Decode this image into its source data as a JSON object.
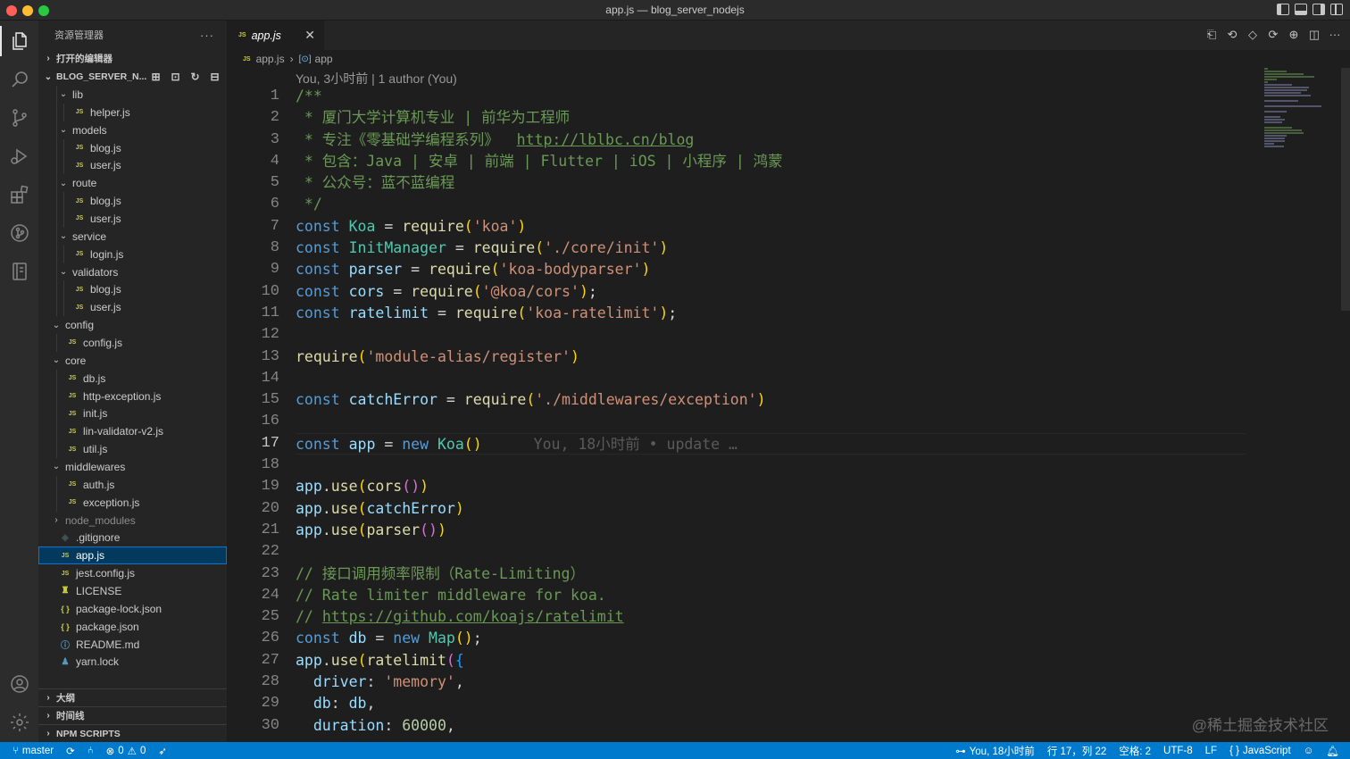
{
  "window": {
    "title": "app.js — blog_server_nodejs"
  },
  "sidebar": {
    "header": "资源管理器",
    "open_editors": "打开的编辑器",
    "project": "BLOG_SERVER_N...",
    "tree": [
      {
        "label": "lib",
        "type": "folder",
        "depth": 1
      },
      {
        "label": "helper.js",
        "type": "js",
        "depth": 2
      },
      {
        "label": "models",
        "type": "folder",
        "depth": 1
      },
      {
        "label": "blog.js",
        "type": "js",
        "depth": 2
      },
      {
        "label": "user.js",
        "type": "js",
        "depth": 2
      },
      {
        "label": "route",
        "type": "folder",
        "depth": 1
      },
      {
        "label": "blog.js",
        "type": "js",
        "depth": 2
      },
      {
        "label": "user.js",
        "type": "js",
        "depth": 2
      },
      {
        "label": "service",
        "type": "folder",
        "depth": 1
      },
      {
        "label": "login.js",
        "type": "js",
        "depth": 2
      },
      {
        "label": "validators",
        "type": "folder",
        "depth": 1
      },
      {
        "label": "blog.js",
        "type": "js",
        "depth": 2
      },
      {
        "label": "user.js",
        "type": "js",
        "depth": 2
      },
      {
        "label": "config",
        "type": "folder",
        "depth": 0
      },
      {
        "label": "config.js",
        "type": "js",
        "depth": 1
      },
      {
        "label": "core",
        "type": "folder",
        "depth": 0
      },
      {
        "label": "db.js",
        "type": "js",
        "depth": 1
      },
      {
        "label": "http-exception.js",
        "type": "js",
        "depth": 1
      },
      {
        "label": "init.js",
        "type": "js",
        "depth": 1
      },
      {
        "label": "lin-validator-v2.js",
        "type": "js",
        "depth": 1
      },
      {
        "label": "util.js",
        "type": "js",
        "depth": 1
      },
      {
        "label": "middlewares",
        "type": "folder",
        "depth": 0
      },
      {
        "label": "auth.js",
        "type": "js",
        "depth": 1
      },
      {
        "label": "exception.js",
        "type": "js",
        "depth": 1
      },
      {
        "label": "node_modules",
        "type": "folder-closed",
        "depth": 0
      },
      {
        "label": ".gitignore",
        "type": "git",
        "depth": 0
      },
      {
        "label": "app.js",
        "type": "js",
        "depth": 0
      },
      {
        "label": "jest.config.js",
        "type": "js",
        "depth": 0
      },
      {
        "label": "LICENSE",
        "type": "license",
        "depth": 0
      },
      {
        "label": "package-lock.json",
        "type": "json",
        "depth": 0
      },
      {
        "label": "package.json",
        "type": "json",
        "depth": 0
      },
      {
        "label": "README.md",
        "type": "info",
        "depth": 0
      },
      {
        "label": "yarn.lock",
        "type": "yarn",
        "depth": 0
      }
    ],
    "outline": "大纲",
    "timeline": "时间线",
    "npm_scripts": "NPM SCRIPTS"
  },
  "editor": {
    "tab_label": "app.js",
    "breadcrumb_file": "app.js",
    "breadcrumb_symbol": "app",
    "codelens": "You, 3小时前 | 1 author (You)",
    "current_line": 17,
    "blame": "You, 18小时前 • update …",
    "line_numbers": [
      "1",
      "2",
      "3",
      "4",
      "5",
      "6",
      "7",
      "8",
      "9",
      "10",
      "11",
      "12",
      "13",
      "14",
      "15",
      "16",
      "17",
      "18",
      "19",
      "20",
      "21",
      "22",
      "23",
      "24",
      "25",
      "26",
      "27",
      "28",
      "29",
      "30"
    ],
    "lines": [
      "/**",
      " * 厦门大学计算机专业 | 前华为工程师",
      " * 专注《零基础学编程系列》  http://lblbc.cn/blog",
      " * 包含：Java | 安卓 | 前端 | Flutter | iOS | 小程序 | 鸿蒙",
      " * 公众号：蓝不蓝编程",
      " */",
      "const Koa = require('koa')",
      "const InitManager = require('./core/init')",
      "const parser = require('koa-bodyparser')",
      "const cors = require('@koa/cors');",
      "const ratelimit = require('koa-ratelimit');",
      "",
      "require('module-alias/register')",
      "",
      "const catchError = require('./middlewares/exception')",
      "",
      "const app = new Koa()",
      "",
      "app.use(cors())",
      "app.use(catchError)",
      "app.use(parser())",
      "",
      "// 接口调用频率限制（Rate-Limiting）",
      "// Rate limiter middleware for koa.",
      "// https://github.com/koajs/ratelimit",
      "const db = new Map();",
      "app.use(ratelimit({",
      "  driver: 'memory',",
      "  db: db,",
      "  duration: 60000,"
    ]
  },
  "watermark": "@稀土掘金技术社区",
  "statusbar": {
    "branch": "master",
    "errors": "0",
    "warnings": "0",
    "blame": "You, 18小时前",
    "position": "行 17，列 22",
    "spaces": "空格: 2",
    "encoding": "UTF-8",
    "eol": "LF",
    "language": "JavaScript"
  },
  "colors": {
    "statusbar": "#007acc",
    "selection": "#04395e",
    "keyword": "#569cd6",
    "string": "#ce9178",
    "comment": "#6a9955",
    "class": "#4ec9b0",
    "function": "#dcdcaa",
    "variable": "#9cdcfe"
  }
}
